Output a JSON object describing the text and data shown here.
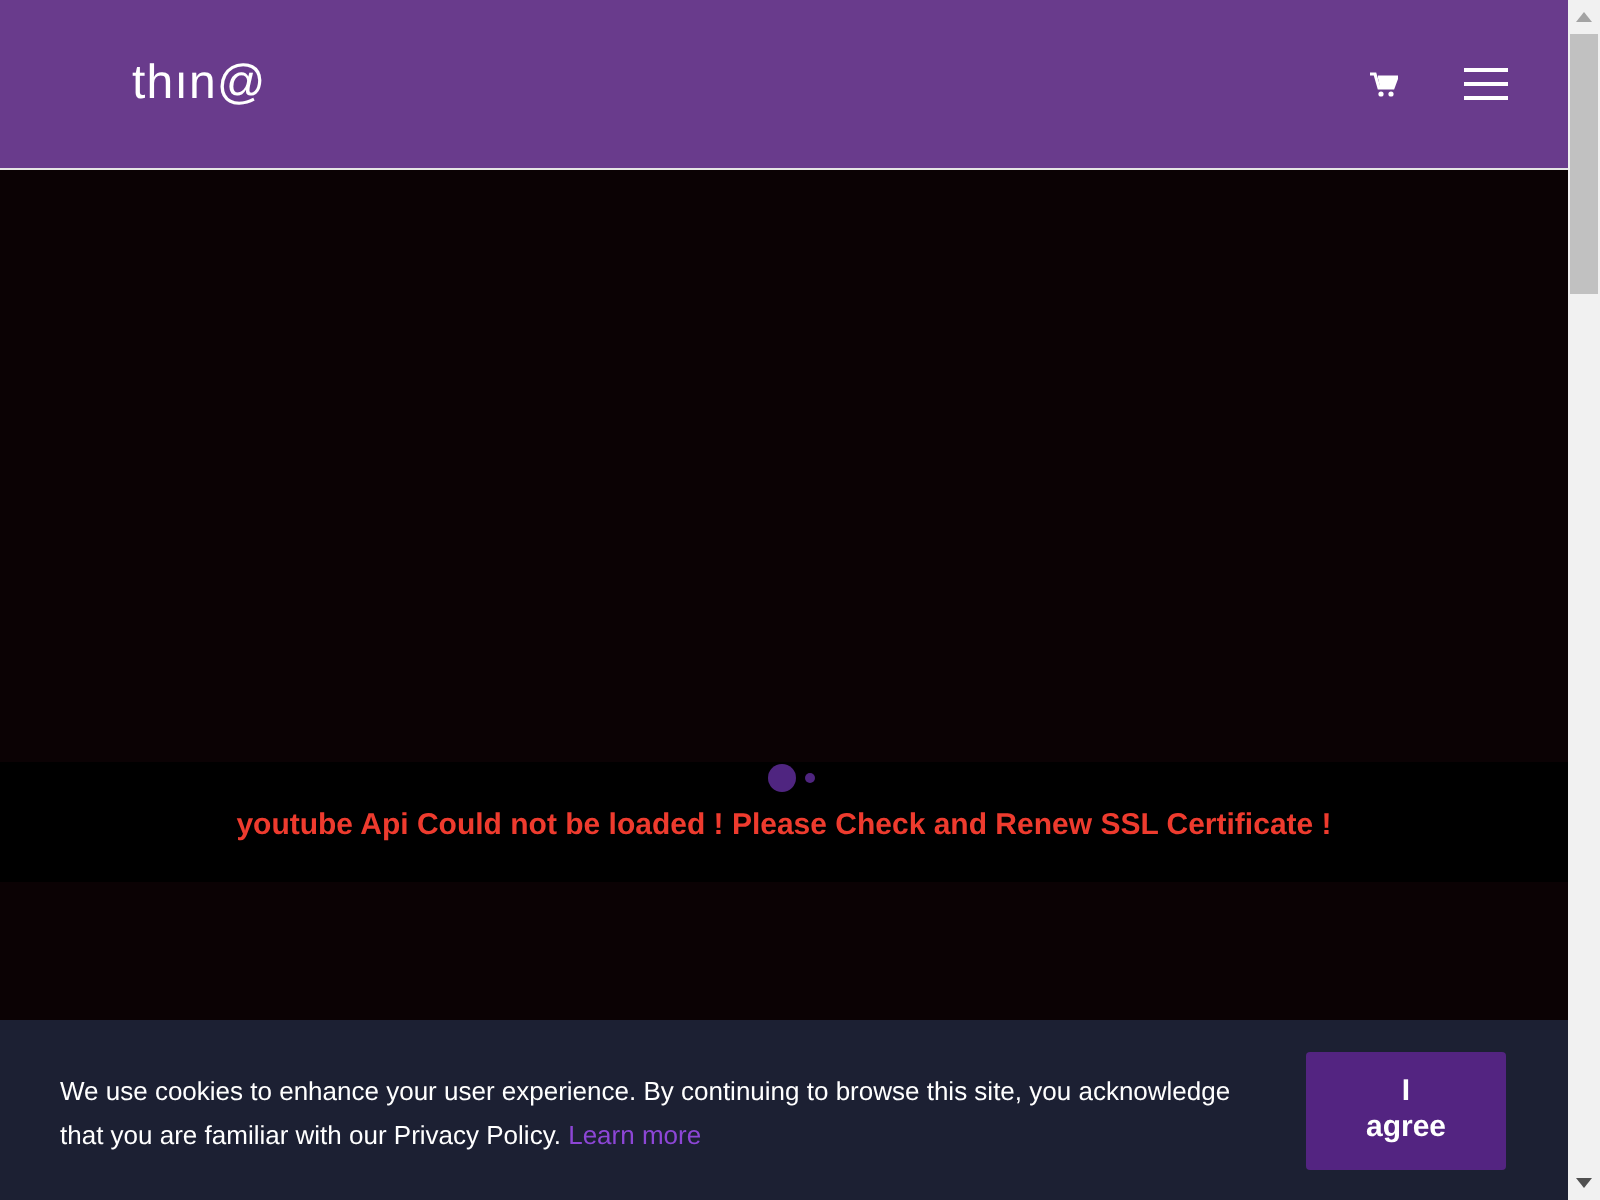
{
  "header": {
    "logo": "thın@"
  },
  "error_message": "youtube Api Could not be loaded ! Please Check and Renew SSL Certificate !",
  "cookie_bar": {
    "text": "We use cookies to enhance your user experience. By continuing to browse this site, you acknowledge that you are familiar with our Privacy Policy.",
    "link": "Learn more",
    "button": "I agree"
  }
}
